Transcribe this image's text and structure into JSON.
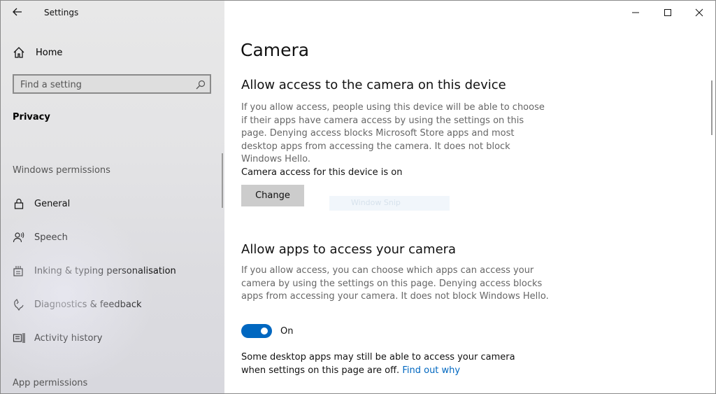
{
  "window": {
    "title": "Settings"
  },
  "sidebar": {
    "home_label": "Home",
    "search_placeholder": "Find a setting",
    "section_title": "Privacy",
    "windows_permissions_label": "Windows permissions",
    "items": [
      {
        "label": "General",
        "icon": "lock-icon"
      },
      {
        "label": "Speech",
        "icon": "speech-icon"
      },
      {
        "label": "Inking & typing personalisation",
        "icon": "inking-icon"
      },
      {
        "label": "Diagnostics & feedback",
        "icon": "diagnostics-icon"
      },
      {
        "label": "Activity history",
        "icon": "activity-icon"
      }
    ],
    "app_permissions_label": "App permissions"
  },
  "main": {
    "page_title": "Camera",
    "device_access": {
      "heading": "Allow access to the camera on this device",
      "description": "If you allow access, people using this device will be able to choose if their apps have camera access by using the settings on this page. Denying access blocks Microsoft Store apps and most desktop apps from accessing the camera. It does not block Windows Hello.",
      "status": "Camera access for this device is on",
      "change_button": "Change"
    },
    "ghost_text": "Window Snip",
    "app_access": {
      "heading": "Allow apps to access your camera",
      "description": "If you allow access, you can choose which apps can access your camera by using the settings on this page. Denying access blocks apps from accessing your camera. It does not block Windows Hello.",
      "toggle_state": "On",
      "note": "Some desktop apps may still be able to access your camera when settings on this page are off.",
      "link": "Find out why"
    }
  },
  "colors": {
    "accent": "#0067c0"
  }
}
